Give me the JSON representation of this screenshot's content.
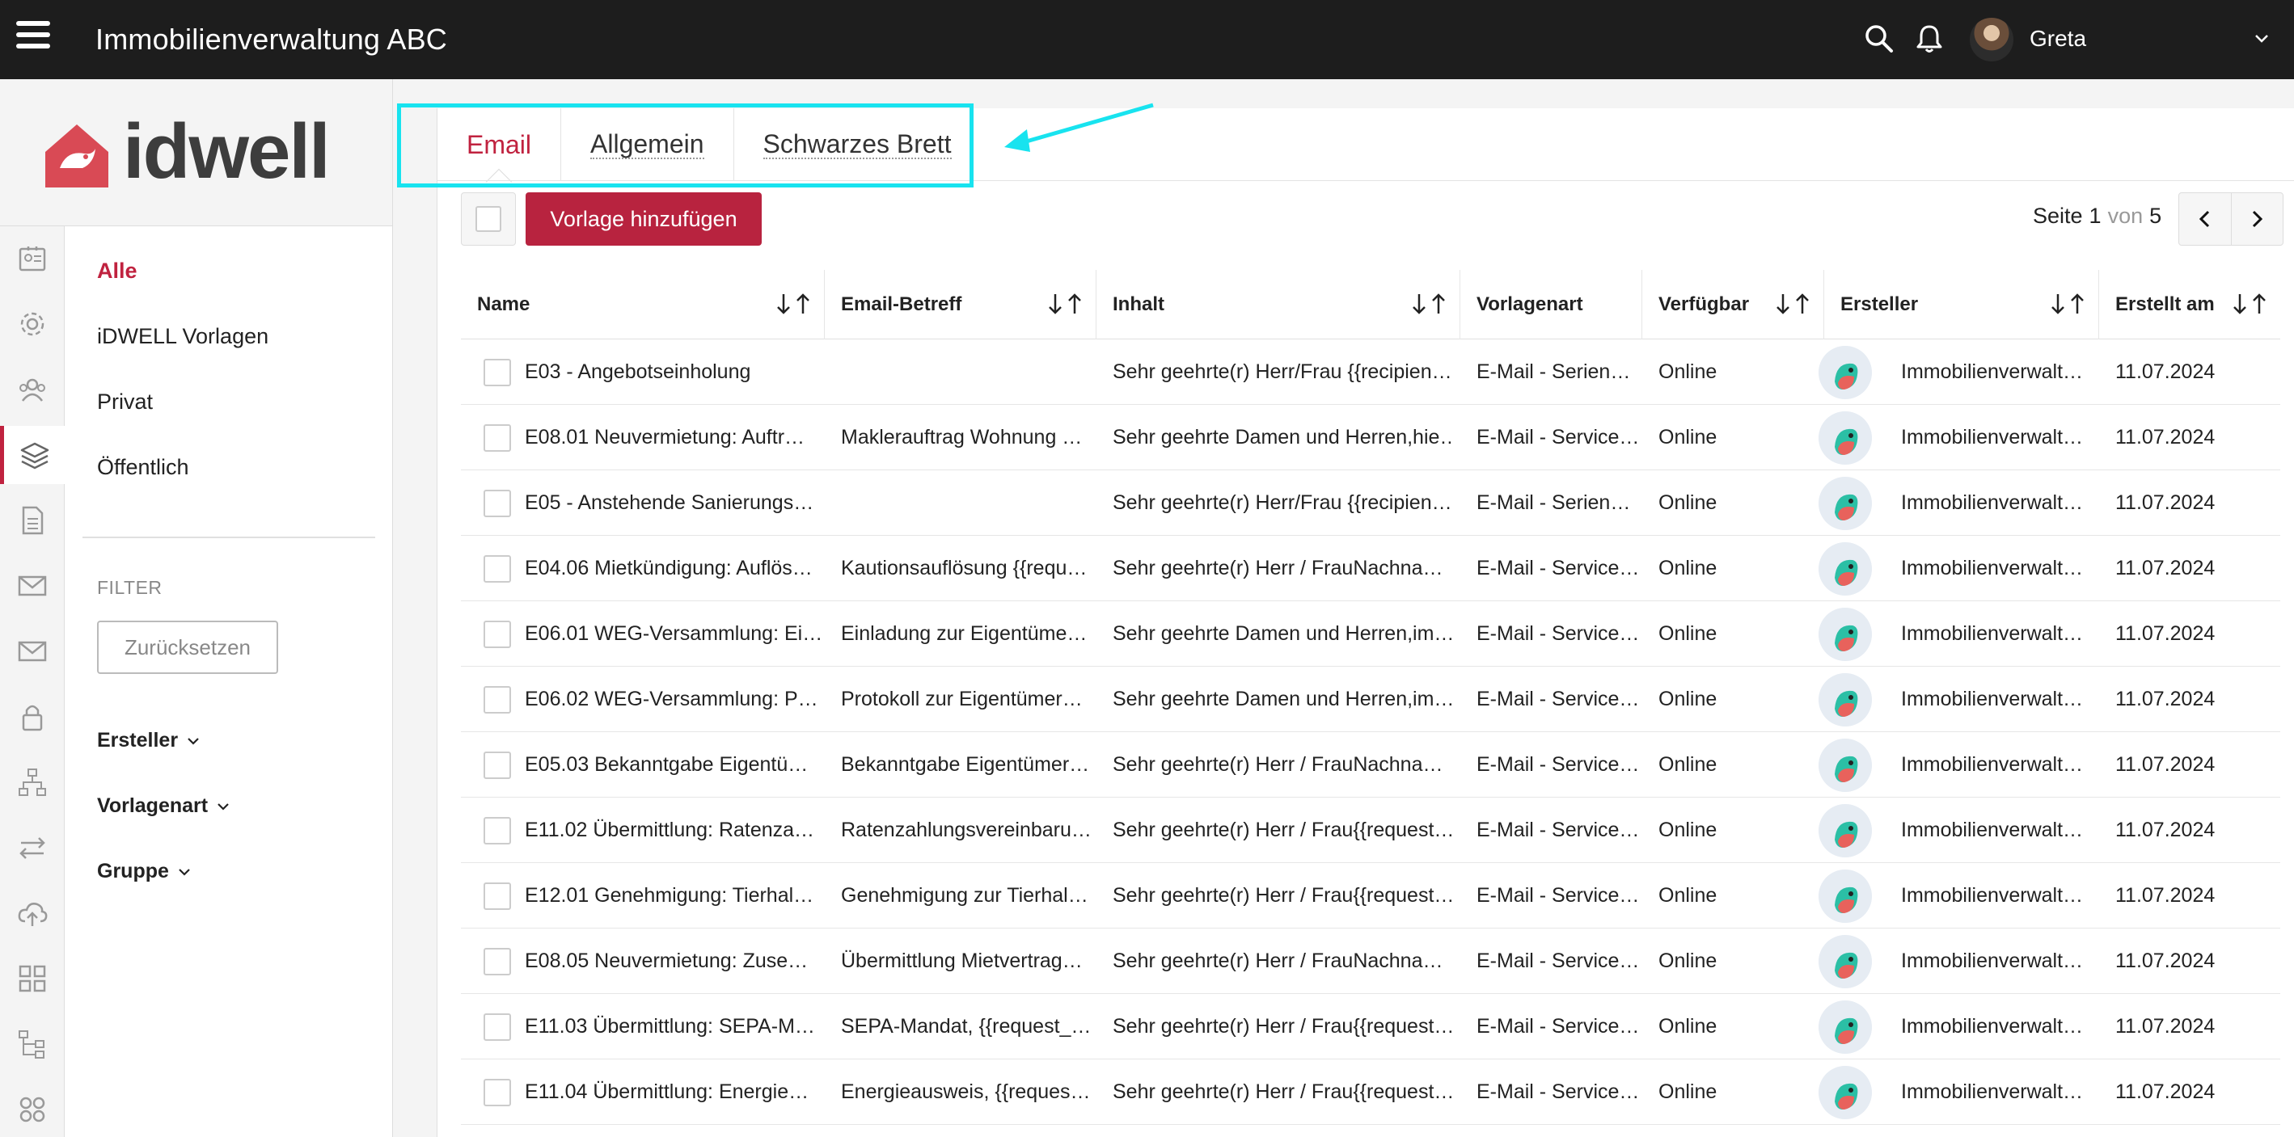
{
  "topbar": {
    "title": "Immobilienverwaltung ABC",
    "user_name": "Greta"
  },
  "logo": {
    "text": "idwell"
  },
  "rail": [
    {
      "name": "contacts-icon"
    },
    {
      "name": "settings-icon"
    },
    {
      "name": "users-icon"
    },
    {
      "name": "layers-icon"
    },
    {
      "name": "document-icon"
    },
    {
      "name": "mail-icon"
    },
    {
      "name": "mail-alt-icon"
    },
    {
      "name": "lock-icon"
    },
    {
      "name": "org-chart-icon"
    },
    {
      "name": "transfer-icon"
    },
    {
      "name": "cloud-upload-icon"
    },
    {
      "name": "grid-icon"
    },
    {
      "name": "tree-icon"
    },
    {
      "name": "apps-icon"
    }
  ],
  "sidebar": {
    "items": [
      "Alle",
      "iDWELL Vorlagen",
      "Privat",
      "Öffentlich"
    ],
    "filter_label": "FILTER",
    "reset_label": "Zurücksetzen",
    "groups": [
      "Ersteller",
      "Vorlagenart",
      "Gruppe"
    ]
  },
  "tabs": [
    "Email",
    "Allgemein",
    "Schwarzes Brett"
  ],
  "toolbar": {
    "add_label": "Vorlage hinzufügen"
  },
  "pager": {
    "page_label": "Seite",
    "current": "1",
    "of_label": "von",
    "total": "5"
  },
  "table": {
    "columns": [
      "Name",
      "Email-Betreff",
      "Inhalt",
      "Vorlagenart",
      "Verfügbar",
      "Ersteller",
      "Erstellt am"
    ],
    "rows": [
      [
        "E03 - Angebotseinholung",
        "",
        "Sehr geehrte(r) Herr/Frau {{recipien…",
        "E-Mail - Serien…",
        "Online",
        "Immobilienverwalt…",
        "11.07.2024"
      ],
      [
        "E08.01 Neuvermietung: Auftr…",
        "Maklerauftrag Wohnung …",
        "Sehr geehrte Damen und Herren,hie…",
        "E-Mail - Service…",
        "Online",
        "Immobilienverwalt…",
        "11.07.2024"
      ],
      [
        "E05 - Anstehende Sanierungs…",
        "",
        "Sehr geehrte(r) Herr/Frau {{recipien…",
        "E-Mail - Serien…",
        "Online",
        "Immobilienverwalt…",
        "11.07.2024"
      ],
      [
        "E04.06 Mietkündigung: Auflös…",
        "Kautionsauflösung {{requ…",
        "Sehr geehrte(r) Herr / FrauNachna…",
        "E-Mail - Service…",
        "Online",
        "Immobilienverwalt…",
        "11.07.2024"
      ],
      [
        "E06.01 WEG-Versammlung: Ei…",
        "Einladung zur Eigentüme…",
        "Sehr geehrte Damen und Herren,im…",
        "E-Mail - Service…",
        "Online",
        "Immobilienverwalt…",
        "11.07.2024"
      ],
      [
        "E06.02 WEG-Versammlung: P…",
        "Protokoll zur Eigentümer…",
        "Sehr geehrte Damen und Herren,im…",
        "E-Mail - Service…",
        "Online",
        "Immobilienverwalt…",
        "11.07.2024"
      ],
      [
        "E05.03 Bekanntgabe Eigentü…",
        "Bekanntgabe Eigentümer…",
        "Sehr geehrte(r) Herr / FrauNachna…",
        "E-Mail - Service…",
        "Online",
        "Immobilienverwalt…",
        "11.07.2024"
      ],
      [
        "E11.02 Übermittlung: Ratenza…",
        "Ratenzahlungsvereinbaru…",
        "Sehr geehrte(r) Herr / Frau{{request…",
        "E-Mail - Service…",
        "Online",
        "Immobilienverwalt…",
        "11.07.2024"
      ],
      [
        "E12.01 Genehmigung: Tierhal…",
        "Genehmigung zur Tierhal…",
        "Sehr geehrte(r) Herr / Frau{{request…",
        "E-Mail - Service…",
        "Online",
        "Immobilienverwalt…",
        "11.07.2024"
      ],
      [
        "E08.05 Neuvermietung: Zuse…",
        "Übermittlung Mietvertrag…",
        "Sehr geehrte(r) Herr / FrauNachna…",
        "E-Mail - Service…",
        "Online",
        "Immobilienverwalt…",
        "11.07.2024"
      ],
      [
        "E11.03 Übermittlung: SEPA-M…",
        "SEPA-Mandat, {{request_…",
        "Sehr geehrte(r) Herr / Frau{{request…",
        "E-Mail - Service…",
        "Online",
        "Immobilienverwalt…",
        "11.07.2024"
      ],
      [
        "E11.04 Übermittlung: Energie…",
        "Energieausweis, {{reques…",
        "Sehr geehrte(r) Herr / Frau{{request…",
        "E-Mail - Service…",
        "Online",
        "Immobilienverwalt…",
        "11.07.2024"
      ]
    ]
  },
  "colors": {
    "accent": "#c0223f",
    "button": "#b8233f",
    "topbar": "#1d1d1d",
    "annotation": "#18e3ef"
  }
}
